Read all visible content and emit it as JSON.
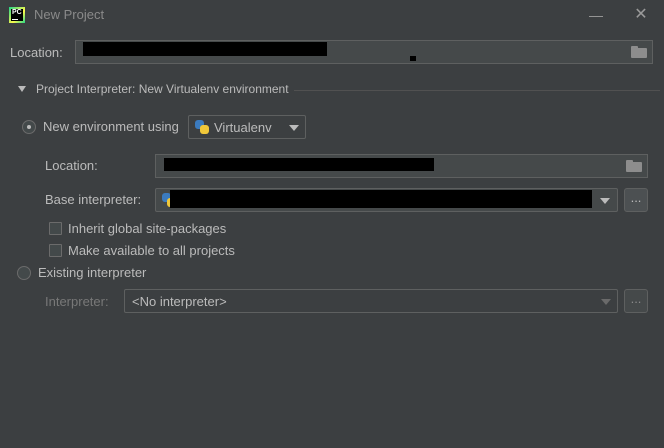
{
  "window": {
    "title": "New Project",
    "app_icon_text": "PC",
    "minimize_glyph": "—",
    "close_glyph": "✕"
  },
  "location": {
    "label": "Location:",
    "value": ""
  },
  "interpreter_section": {
    "title": "Project Interpreter: New Virtualenv environment",
    "new_env": {
      "radio_label": "New environment using",
      "tool": "Virtualenv",
      "location_label": "Location:",
      "location_value": "",
      "base_label": "Base interpreter:",
      "base_value": "",
      "inherit_label": "Inherit global site-packages",
      "make_available_label": "Make available to all projects",
      "browse_label": "..."
    },
    "existing": {
      "radio_label": "Existing interpreter",
      "interpreter_label": "Interpreter:",
      "interpreter_value": "<No interpreter>",
      "browse_label": "..."
    }
  },
  "colors": {
    "background": "#3c3f41",
    "field": "#45494a",
    "text": "#bbbbbb",
    "redaction": "#000000"
  },
  "icons": [
    "pycharm-app-icon",
    "minimize-icon",
    "close-icon",
    "folder-icon",
    "expand-triangle-icon",
    "python-icon",
    "chevron-down-icon"
  ]
}
